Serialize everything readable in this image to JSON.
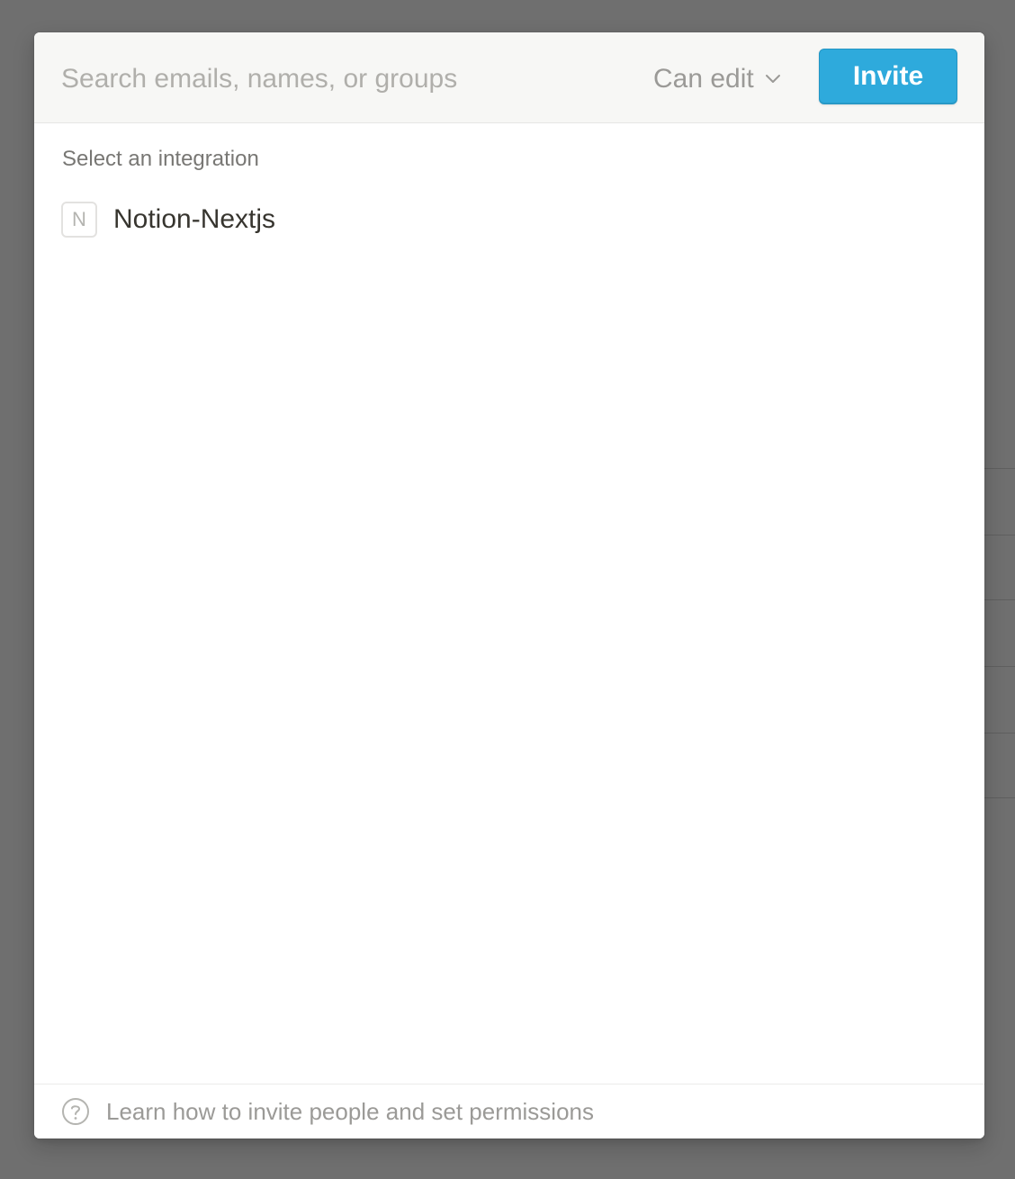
{
  "invite_modal": {
    "search": {
      "placeholder": "Search emails, names, or groups",
      "value": ""
    },
    "permission": {
      "selected": "Can edit",
      "icon": "chevron-down-icon"
    },
    "invite_button": {
      "label": "Invite",
      "color": "#2eaadc"
    },
    "section_label": "Select an integration",
    "integrations": [
      {
        "initial": "N",
        "name": "Notion-Nextjs"
      }
    ],
    "footer": {
      "icon": "help-circle-icon",
      "text": "Learn how to invite people and set permissions"
    }
  }
}
